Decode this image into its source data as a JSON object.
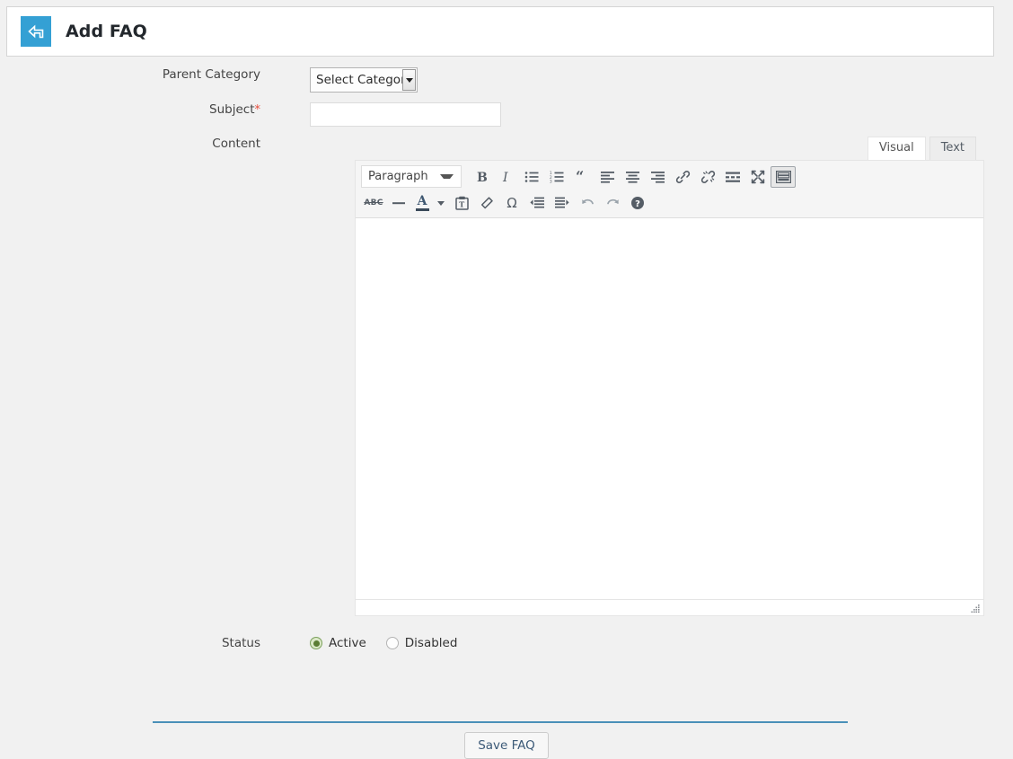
{
  "header": {
    "title": "Add FAQ",
    "back_icon": "back-arrow-icon"
  },
  "form": {
    "parent_category": {
      "label": "Parent Category",
      "selected": "Select Category",
      "options": [
        "Select Category"
      ]
    },
    "subject": {
      "label": "Subject",
      "required_marker": "*",
      "value": "",
      "placeholder": ""
    },
    "content": {
      "label": "Content"
    },
    "status": {
      "label": "Status",
      "options": [
        {
          "label": "Active",
          "checked": true
        },
        {
          "label": "Disabled",
          "checked": false
        }
      ]
    }
  },
  "editor": {
    "tabs": [
      {
        "label": "Visual",
        "active": true
      },
      {
        "label": "Text",
        "active": false
      }
    ],
    "format_select": {
      "selected": "Paragraph",
      "options": [
        "Paragraph"
      ]
    },
    "toolbar_row1": [
      {
        "name": "bold-icon",
        "title": "Bold",
        "pressed": false
      },
      {
        "name": "italic-icon",
        "title": "Italic",
        "pressed": false
      },
      {
        "name": "bullet-list-icon",
        "title": "Bulleted list",
        "pressed": false
      },
      {
        "name": "numbered-list-icon",
        "title": "Numbered list",
        "pressed": false
      },
      {
        "name": "blockquote-icon",
        "title": "Blockquote",
        "pressed": false
      },
      {
        "name": "align-left-icon",
        "title": "Align left",
        "pressed": false
      },
      {
        "name": "align-center-icon",
        "title": "Align center",
        "pressed": false
      },
      {
        "name": "align-right-icon",
        "title": "Align right",
        "pressed": false
      },
      {
        "name": "insert-link-icon",
        "title": "Insert/edit link",
        "pressed": false
      },
      {
        "name": "unlink-icon",
        "title": "Remove link",
        "pressed": false
      },
      {
        "name": "read-more-icon",
        "title": "Insert Read More tag",
        "pressed": false
      },
      {
        "name": "fullscreen-icon",
        "title": "Distraction-free writing mode",
        "pressed": false
      },
      {
        "name": "toolbar-toggle-icon",
        "title": "Toolbar Toggle",
        "pressed": true
      }
    ],
    "toolbar_row2": [
      {
        "name": "strikethrough-icon",
        "title": "Strikethrough",
        "label": "ABC"
      },
      {
        "name": "horizontal-rule-icon",
        "title": "Horizontal line"
      },
      {
        "name": "text-color-icon",
        "title": "Text color"
      },
      {
        "name": "paste-as-text-icon",
        "title": "Paste as text"
      },
      {
        "name": "clear-formatting-icon",
        "title": "Clear formatting"
      },
      {
        "name": "special-character-icon",
        "title": "Special character",
        "label": "Ω"
      },
      {
        "name": "decrease-indent-icon",
        "title": "Decrease indent"
      },
      {
        "name": "increase-indent-icon",
        "title": "Increase indent"
      },
      {
        "name": "undo-icon",
        "title": "Undo"
      },
      {
        "name": "redo-icon",
        "title": "Redo"
      },
      {
        "name": "keyboard-help-icon",
        "title": "Keyboard Shortcuts"
      }
    ],
    "content_value": ""
  },
  "footer": {
    "save_label": "Save FAQ"
  },
  "colors": {
    "accent_blue": "#34a0d4",
    "divider_blue": "#4a90b8",
    "required_red": "#e74c3c",
    "radio_green": "#5b7d35",
    "page_bg": "#f1f1f1"
  }
}
